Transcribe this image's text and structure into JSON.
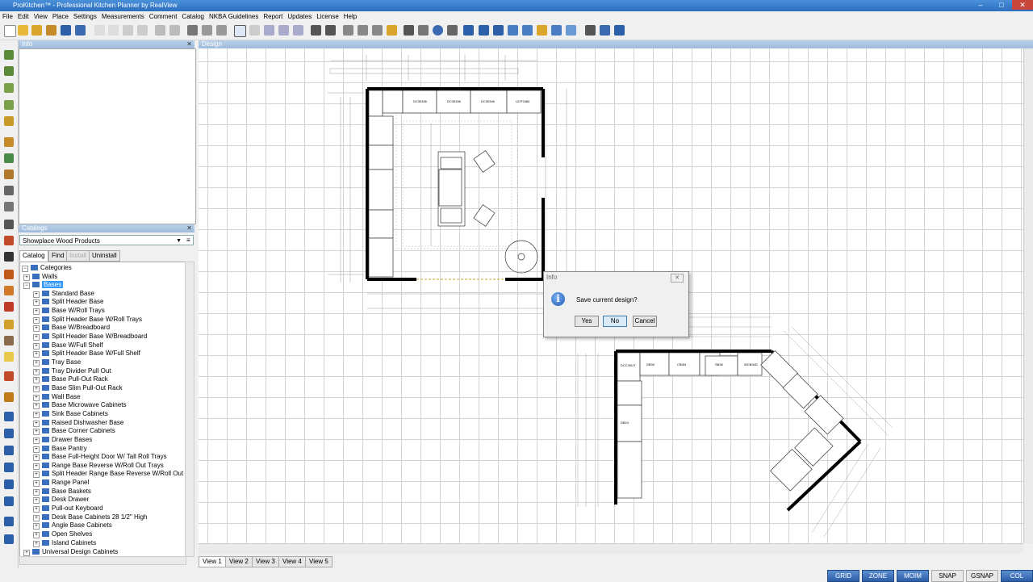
{
  "window": {
    "title": "ProKitchen™ - Professional Kitchen Planner by RealView",
    "min": "–",
    "max": "□",
    "close": "✕"
  },
  "menu": [
    "File",
    "Edit",
    "View",
    "Place",
    "Settings",
    "Measurements",
    "Comment",
    "Catalog",
    "NKBA Guidelines",
    "Report",
    "Updates",
    "License",
    "Help"
  ],
  "info_panel": {
    "title": "Info",
    "close": "✕"
  },
  "design_panel": {
    "title": "Design"
  },
  "catalogs": {
    "title": "Catalogs",
    "close": "✕",
    "selected_catalog": "Showplace Wood Products",
    "tabs": [
      "Catalog",
      "Find",
      "Install",
      "Uninstall"
    ],
    "tree": {
      "root": "Categories",
      "walls": "Walls",
      "bases": "Bases",
      "items": [
        "Standard Base",
        "Split Header Base",
        "Base W/Roll Trays",
        "Split Header Base W/Roll Trays",
        "Base W/Breadboard",
        "Split Header Base W/Breadboard",
        "Base W/Full Shelf",
        "Split Header Base W/Full Shelf",
        "Tray Base",
        "Tray Divider Pull Out",
        "Base Pull-Out Rack",
        "Base Slim Pull-Out Rack",
        "Wall Base",
        "Base Microwave Cabinets",
        "Sink Base Cabinets",
        "Raised Dishwasher Base",
        "Base Corner Cabinets",
        "Drawer Bases",
        "Base Pantry",
        "Base Full-Height Door W/ Tall Roll Trays",
        "Range Base Reverse W/Roll Out Trays",
        "Split Header Range Base Reverse W/Roll Out",
        "Range Panel",
        "Base Baskets",
        "Desk Drawer",
        "Pull-out Keyboard",
        "Desk Base Cabinets 28 1/2\" High",
        "Angle Base Cabinets",
        "Open Shelves",
        "Island Cabinets"
      ],
      "after": "Universal Design Cabinets"
    }
  },
  "view_tabs": [
    "View 1",
    "View 2",
    "View 3",
    "View 4",
    "View 5"
  ],
  "status_buttons": [
    "GRID",
    "ZONE",
    "MOIM",
    "SNAP",
    "GSNAP",
    "COL"
  ],
  "dialog": {
    "title": "Info",
    "close": "✕",
    "message": "Save current design?",
    "buttons": {
      "yes": "Yes",
      "no": "No",
      "cancel": "Cancel"
    }
  },
  "plan1_labels": [
    "DC30346",
    "DC30346",
    "DC30346",
    "UCP2484"
  ],
  "plan2_labels": [
    "DCC30UT",
    "DB30",
    "CBI84",
    "SB36",
    "WCB34D",
    "DB24"
  ]
}
